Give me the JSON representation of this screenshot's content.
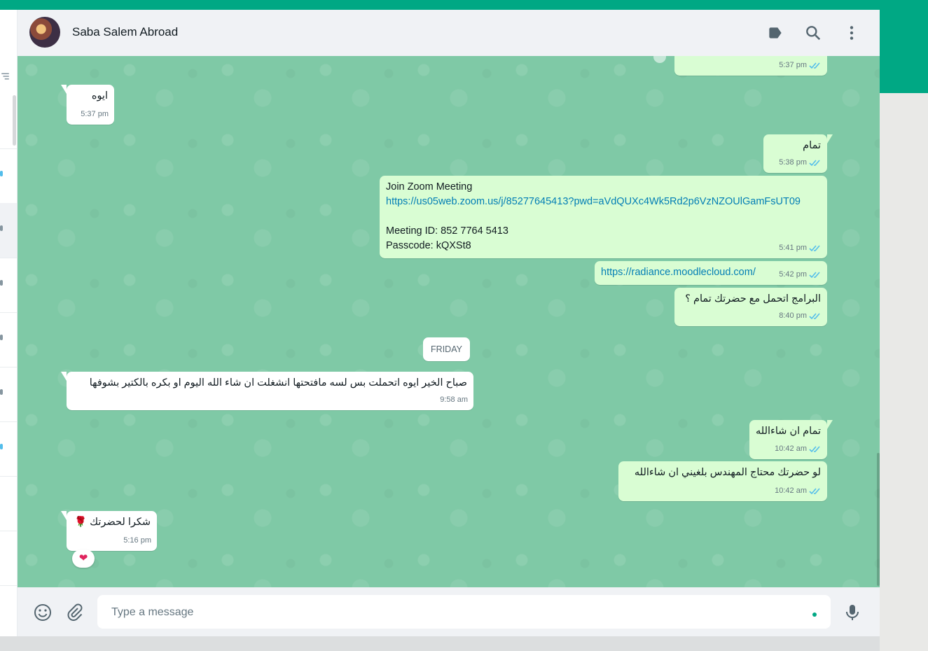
{
  "header": {
    "contact_name": "Saba Salem Abroad",
    "icons": [
      "label-icon",
      "search-icon",
      "menu-icon"
    ]
  },
  "messages": [
    {
      "dir": "out",
      "text": "",
      "time": "5:37 pm",
      "read": true
    },
    {
      "dir": "in",
      "text": "ايوه",
      "time": "5:37 pm"
    },
    {
      "dir": "out",
      "text": "تمام",
      "time": "5:38 pm",
      "read": true
    },
    {
      "dir": "out",
      "lines": [
        "Join Zoom Meeting",
        "https://us05web.zoom.us/j/85277645413?pwd=aVdQUXc4Wk5Rd2p6VzNZOUlGamFsUT09",
        "",
        "Meeting ID: 852 7764 5413",
        "Passcode: kQXSt8"
      ],
      "time": "5:41 pm",
      "read": true
    },
    {
      "dir": "out",
      "text": "https://radiance.moodlecloud.com/",
      "time": "5:42 pm",
      "read": true
    },
    {
      "dir": "out",
      "text": "البرامج اتحمل مع حضرتك تمام ؟",
      "time": "8:40 pm",
      "read": true
    },
    {
      "dir": "in",
      "text": "صباح الخير ايوه اتحملت بس لسه مافتحتها انشغلت ان شاء الله اليوم او بكره بالكتير بشوفها",
      "time": "9:58 am"
    },
    {
      "dir": "out",
      "text": "تمام ان شاءالله",
      "time": "10:42 am",
      "read": true
    },
    {
      "dir": "out",
      "text": "لو حضرتك محتاج المهندس بلغيني ان شاءالله",
      "time": "10:42 am",
      "read": true
    },
    {
      "dir": "in",
      "text": "شكرا لحضرتك 🌹",
      "time": "5:16 pm",
      "reaction": "❤"
    }
  ],
  "day_chip": "FRIDAY",
  "composer": {
    "placeholder": "Type a message"
  },
  "colors": {
    "accent": "#00a884",
    "outgoing": "#d9fdd3",
    "incoming": "#ffffff",
    "read_check": "#53bdeb"
  }
}
